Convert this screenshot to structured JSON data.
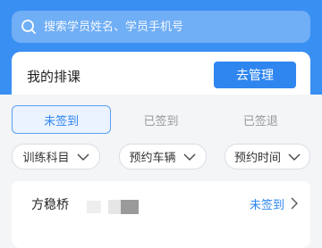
{
  "search": {
    "placeholder": "搜索学员姓名、学员手机号"
  },
  "schedule": {
    "title": "我的排课",
    "manage_label": "去管理"
  },
  "tabs": [
    {
      "label": "未签到",
      "active": true
    },
    {
      "label": "已签到",
      "active": false
    },
    {
      "label": "已签退",
      "active": false
    }
  ],
  "filters": [
    {
      "label": "训练科目"
    },
    {
      "label": "预约车辆"
    },
    {
      "label": "预约时间"
    }
  ],
  "students": [
    {
      "name": "方稳桥",
      "status": "未签到"
    }
  ],
  "colors": {
    "primary": "#2f86ef",
    "header": "#3a8ff2",
    "background": "#f4f5f7"
  }
}
